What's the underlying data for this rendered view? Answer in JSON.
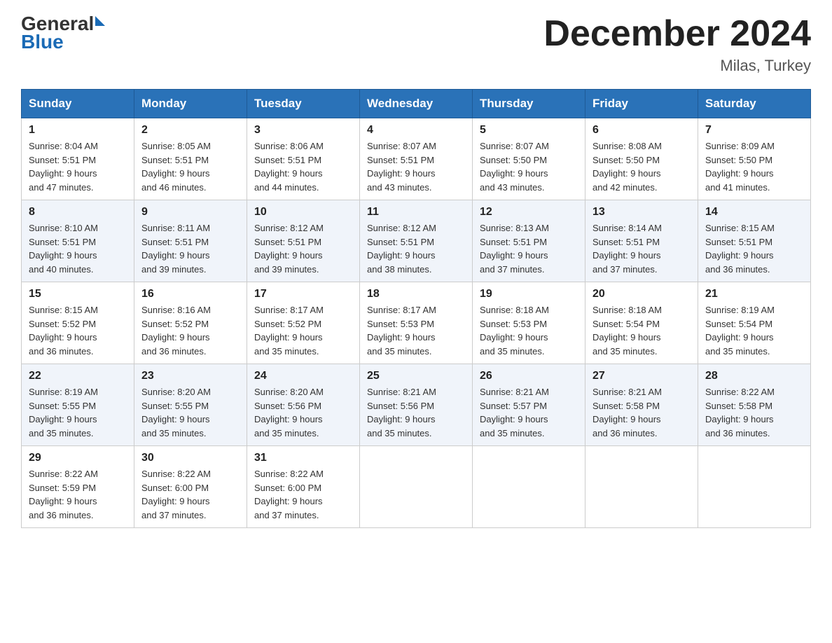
{
  "header": {
    "logo_general": "General",
    "logo_blue": "Blue",
    "main_title": "December 2024",
    "subtitle": "Milas, Turkey"
  },
  "days_of_week": [
    "Sunday",
    "Monday",
    "Tuesday",
    "Wednesday",
    "Thursday",
    "Friday",
    "Saturday"
  ],
  "weeks": [
    [
      {
        "day": "1",
        "sunrise": "8:04 AM",
        "sunset": "5:51 PM",
        "daylight": "9 hours and 47 minutes."
      },
      {
        "day": "2",
        "sunrise": "8:05 AM",
        "sunset": "5:51 PM",
        "daylight": "9 hours and 46 minutes."
      },
      {
        "day": "3",
        "sunrise": "8:06 AM",
        "sunset": "5:51 PM",
        "daylight": "9 hours and 44 minutes."
      },
      {
        "day": "4",
        "sunrise": "8:07 AM",
        "sunset": "5:51 PM",
        "daylight": "9 hours and 43 minutes."
      },
      {
        "day": "5",
        "sunrise": "8:07 AM",
        "sunset": "5:50 PM",
        "daylight": "9 hours and 43 minutes."
      },
      {
        "day": "6",
        "sunrise": "8:08 AM",
        "sunset": "5:50 PM",
        "daylight": "9 hours and 42 minutes."
      },
      {
        "day": "7",
        "sunrise": "8:09 AM",
        "sunset": "5:50 PM",
        "daylight": "9 hours and 41 minutes."
      }
    ],
    [
      {
        "day": "8",
        "sunrise": "8:10 AM",
        "sunset": "5:51 PM",
        "daylight": "9 hours and 40 minutes."
      },
      {
        "day": "9",
        "sunrise": "8:11 AM",
        "sunset": "5:51 PM",
        "daylight": "9 hours and 39 minutes."
      },
      {
        "day": "10",
        "sunrise": "8:12 AM",
        "sunset": "5:51 PM",
        "daylight": "9 hours and 39 minutes."
      },
      {
        "day": "11",
        "sunrise": "8:12 AM",
        "sunset": "5:51 PM",
        "daylight": "9 hours and 38 minutes."
      },
      {
        "day": "12",
        "sunrise": "8:13 AM",
        "sunset": "5:51 PM",
        "daylight": "9 hours and 37 minutes."
      },
      {
        "day": "13",
        "sunrise": "8:14 AM",
        "sunset": "5:51 PM",
        "daylight": "9 hours and 37 minutes."
      },
      {
        "day": "14",
        "sunrise": "8:15 AM",
        "sunset": "5:51 PM",
        "daylight": "9 hours and 36 minutes."
      }
    ],
    [
      {
        "day": "15",
        "sunrise": "8:15 AM",
        "sunset": "5:52 PM",
        "daylight": "9 hours and 36 minutes."
      },
      {
        "day": "16",
        "sunrise": "8:16 AM",
        "sunset": "5:52 PM",
        "daylight": "9 hours and 36 minutes."
      },
      {
        "day": "17",
        "sunrise": "8:17 AM",
        "sunset": "5:52 PM",
        "daylight": "9 hours and 35 minutes."
      },
      {
        "day": "18",
        "sunrise": "8:17 AM",
        "sunset": "5:53 PM",
        "daylight": "9 hours and 35 minutes."
      },
      {
        "day": "19",
        "sunrise": "8:18 AM",
        "sunset": "5:53 PM",
        "daylight": "9 hours and 35 minutes."
      },
      {
        "day": "20",
        "sunrise": "8:18 AM",
        "sunset": "5:54 PM",
        "daylight": "9 hours and 35 minutes."
      },
      {
        "day": "21",
        "sunrise": "8:19 AM",
        "sunset": "5:54 PM",
        "daylight": "9 hours and 35 minutes."
      }
    ],
    [
      {
        "day": "22",
        "sunrise": "8:19 AM",
        "sunset": "5:55 PM",
        "daylight": "9 hours and 35 minutes."
      },
      {
        "day": "23",
        "sunrise": "8:20 AM",
        "sunset": "5:55 PM",
        "daylight": "9 hours and 35 minutes."
      },
      {
        "day": "24",
        "sunrise": "8:20 AM",
        "sunset": "5:56 PM",
        "daylight": "9 hours and 35 minutes."
      },
      {
        "day": "25",
        "sunrise": "8:21 AM",
        "sunset": "5:56 PM",
        "daylight": "9 hours and 35 minutes."
      },
      {
        "day": "26",
        "sunrise": "8:21 AM",
        "sunset": "5:57 PM",
        "daylight": "9 hours and 35 minutes."
      },
      {
        "day": "27",
        "sunrise": "8:21 AM",
        "sunset": "5:58 PM",
        "daylight": "9 hours and 36 minutes."
      },
      {
        "day": "28",
        "sunrise": "8:22 AM",
        "sunset": "5:58 PM",
        "daylight": "9 hours and 36 minutes."
      }
    ],
    [
      {
        "day": "29",
        "sunrise": "8:22 AM",
        "sunset": "5:59 PM",
        "daylight": "9 hours and 36 minutes."
      },
      {
        "day": "30",
        "sunrise": "8:22 AM",
        "sunset": "6:00 PM",
        "daylight": "9 hours and 37 minutes."
      },
      {
        "day": "31",
        "sunrise": "8:22 AM",
        "sunset": "6:00 PM",
        "daylight": "9 hours and 37 minutes."
      },
      null,
      null,
      null,
      null
    ]
  ]
}
